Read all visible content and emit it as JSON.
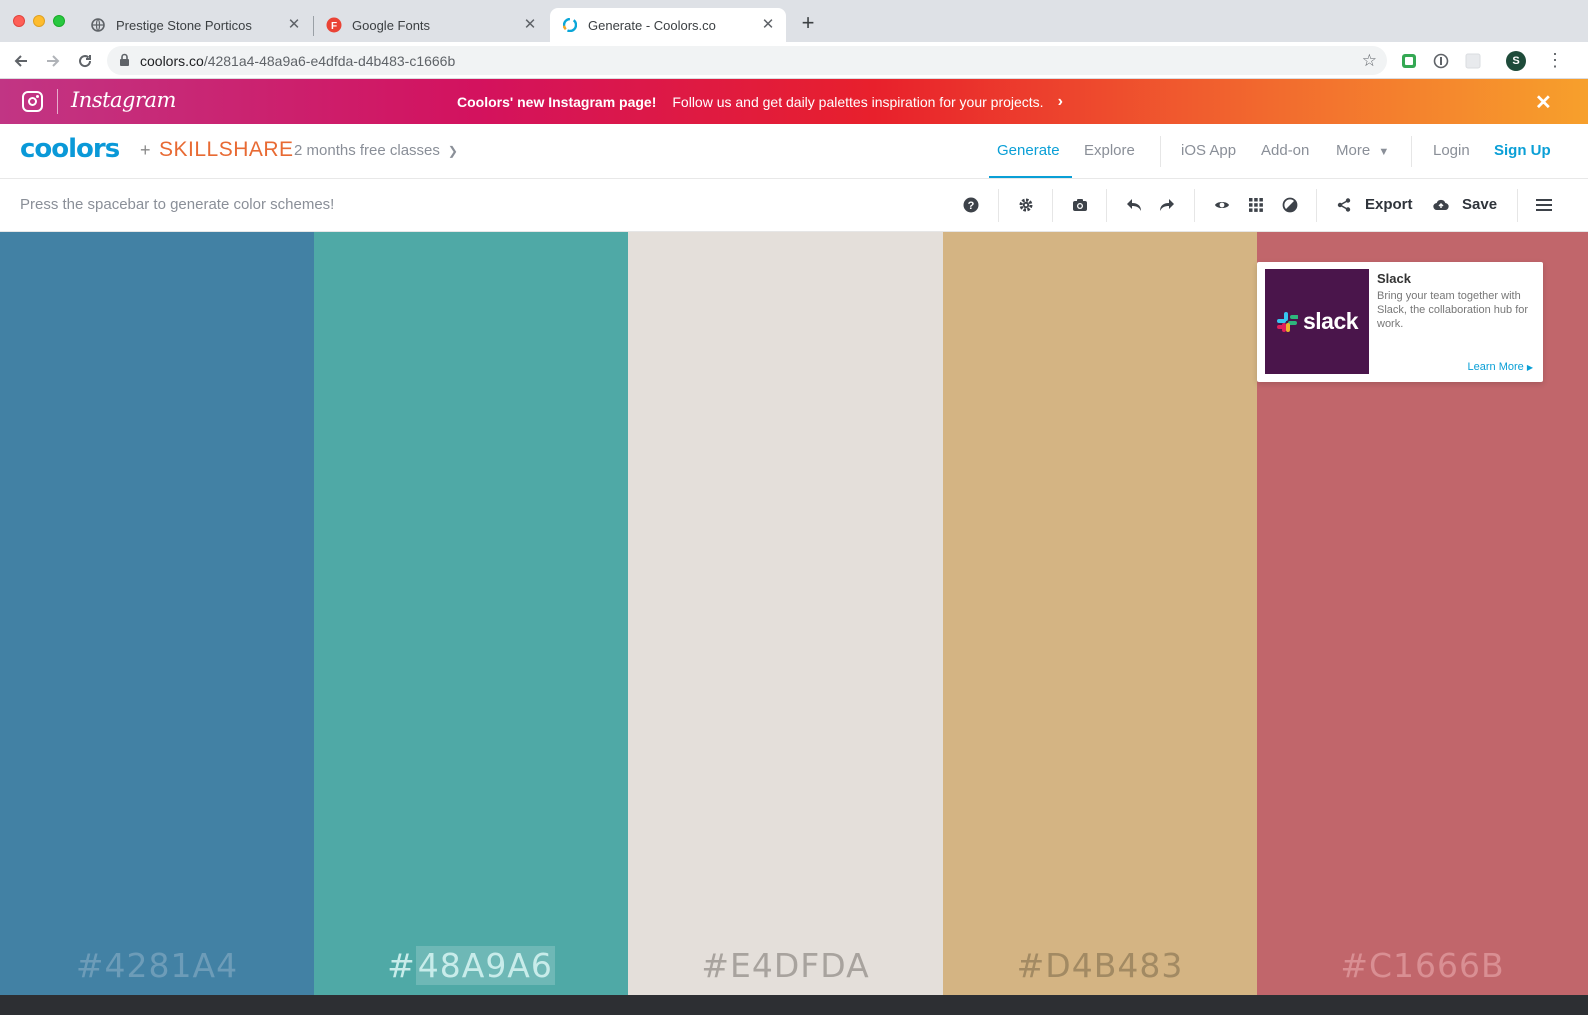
{
  "browser": {
    "tabs": [
      {
        "title": "Prestige Stone Porticos",
        "icon": "globe-icon",
        "active": false
      },
      {
        "title": "Google Fonts",
        "icon": "google-fonts-icon",
        "active": false
      },
      {
        "title": "Generate - Coolors.co",
        "icon": "coolors-icon",
        "active": true
      }
    ],
    "url_host": "coolors.co",
    "url_path": "/4281a4-48a9a6-e4dfda-d4b483-c1666b",
    "profile_initial": "S"
  },
  "banner": {
    "brand": "Instagram",
    "headline": "Coolors' new Instagram page!",
    "message": "Follow us and get daily palettes inspiration for your projects.",
    "close": "✕"
  },
  "nav": {
    "logo": "coolors",
    "plus": "+",
    "partner": "SKILLSHARE",
    "promo": "2 months free classes",
    "links": {
      "generate": "Generate",
      "explore": "Explore",
      "ios": "iOS App",
      "addon": "Add-on",
      "more": "More",
      "login": "Login",
      "signup": "Sign Up"
    },
    "accent": "#0a9fd6"
  },
  "toolbar": {
    "hint": "Press the spacebar to generate color schemes!",
    "export": "Export",
    "save": "Save",
    "icons": [
      "help-icon",
      "settings-icon",
      "camera-icon",
      "undo-icon",
      "redo-icon",
      "view-icon",
      "grid-icon",
      "adjust-icon",
      "share-icon",
      "cloud-upload-icon",
      "menu-icon"
    ]
  },
  "palette": {
    "colors": [
      {
        "hex": "#4281A4",
        "bg": "#4281a4",
        "text": "#6d9cb8"
      },
      {
        "hex": "#48A9A6",
        "bg": "#4fa9a6",
        "text": "#c8ecea"
      },
      {
        "hex": "#E4DFDA",
        "bg": "#e4dfda",
        "text": "#a8a39e"
      },
      {
        "hex": "#D4B483",
        "bg": "#d4b483",
        "text": "#a28a63"
      },
      {
        "hex": "#C1666B",
        "bg": "#c1666b",
        "text": "#d98f93"
      }
    ]
  },
  "ad": {
    "title": "Slack",
    "body": "Bring your team together with Slack, the collaboration hub for work.",
    "cta": "Learn More",
    "image_text": "slack"
  }
}
